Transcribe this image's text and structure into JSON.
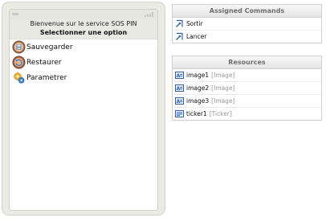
{
  "phone": {
    "header": {
      "welcome": "Bienvenue sur le service SOS PIN",
      "prompt": "Selectionner une option"
    },
    "options": [
      {
        "label": "Sauvegarder",
        "icon": "save-icon"
      },
      {
        "label": "Restaurer",
        "icon": "restore-icon"
      },
      {
        "label": "Parametrer",
        "icon": "settings-icon"
      }
    ]
  },
  "commands": {
    "title": "Assigned Commands",
    "items": [
      {
        "label": "Sortir",
        "icon": "command-icon"
      },
      {
        "label": "Lancer",
        "icon": "command-icon"
      }
    ]
  },
  "resources": {
    "title": "Resources",
    "items": [
      {
        "name": "image1",
        "type": "[Image]",
        "icon": "image-resource-icon"
      },
      {
        "name": "image2",
        "type": "[Image]",
        "icon": "image-resource-icon"
      },
      {
        "name": "image3",
        "type": "[Image]",
        "icon": "image-resource-icon"
      },
      {
        "name": "ticker1",
        "type": "[Ticker]",
        "icon": "ticker-resource-icon"
      }
    ]
  },
  "colors": {
    "phone_frame": "#ebebe6",
    "panel_border": "#d0d0d0",
    "panel_title_text": "#6e6e6e",
    "resource_type_text": "#9a9a9a",
    "icon_blue": "#2f62b7"
  }
}
